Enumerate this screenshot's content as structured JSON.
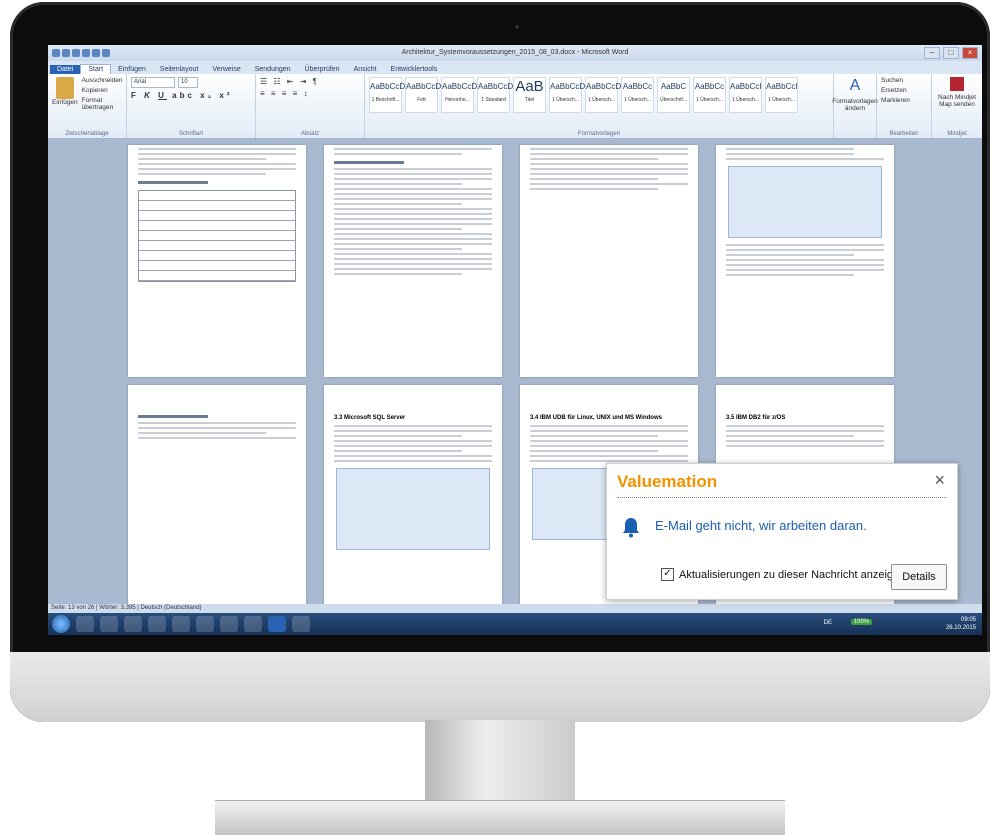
{
  "word": {
    "window_title": "Architektur_Systemvoraussetzungen_2015_08_03.docx - Microsoft Word",
    "tabs": [
      "Datei",
      "Start",
      "Einfügen",
      "Seitenlayout",
      "Verweise",
      "Sendungen",
      "Überprüfen",
      "Ansicht",
      "Entwicklertools"
    ],
    "clipboard": {
      "paste": "Einfügen",
      "cut": "Ausschneiden",
      "copy": "Kopieren",
      "format_painter": "Format übertragen",
      "group": "Zwischenablage"
    },
    "font": {
      "name": "Arial",
      "size": "10",
      "group": "Schriftart"
    },
    "paragraph_group": "Absatz",
    "styles": [
      {
        "sample": "AaBbCcD",
        "name": "1 Beschrift..."
      },
      {
        "sample": "AaBbCcDd",
        "name": "Fett"
      },
      {
        "sample": "AaBbCcDc",
        "name": "Hervorhe..."
      },
      {
        "sample": "AaBbCcDc",
        "name": "1 Standard"
      },
      {
        "sample": "AaB",
        "name": "Titel"
      },
      {
        "sample": "AaBbCcD",
        "name": "1 Übersch..."
      },
      {
        "sample": "AaBbCcDd",
        "name": "1 Übersch..."
      },
      {
        "sample": "AaBbCc",
        "name": "1 Übersch..."
      },
      {
        "sample": "AaBbC",
        "name": "Überschrif..."
      },
      {
        "sample": "AaBbCc",
        "name": "1 Übersch..."
      },
      {
        "sample": "AaBbCcI",
        "name": "1 Übersch..."
      },
      {
        "sample": "AaBbCcI",
        "name": "1 Übersch..."
      }
    ],
    "styles_group": "Formatvorlagen",
    "change_styles": "Formatvorlagen ändern",
    "editing": {
      "find": "Suchen",
      "replace": "Ersetzen",
      "select": "Markieren",
      "group": "Bearbeiten"
    },
    "mindjet": {
      "label": "Nach Mindjet Map senden",
      "group": "Mindjet"
    },
    "status": "Seite: 13 von 26   |   Wörter: 3.395   |   Deutsch (Deutschland)",
    "pages_bottom_headings": [
      "",
      "3.3 Microsoft SQL Server",
      "3.4 IBM UDB für Linux, UNIX und MS Windows",
      "3.5 IBM DB2 für z/OS"
    ]
  },
  "taskbar": {
    "time": "09:05",
    "date": "26.10.2015",
    "lang": "DE",
    "zoom": "100%"
  },
  "toast": {
    "title": "Valuemation",
    "message": "E-Mail geht nicht, wir arbeiten daran.",
    "checkbox_label": "Aktualisierungen zu dieser Nachricht anzeigen",
    "checkbox_checked": "✓",
    "details_button": "Details",
    "close_glyph": "×",
    "accent_color": "#f39200",
    "message_color": "#1b5fb0"
  }
}
